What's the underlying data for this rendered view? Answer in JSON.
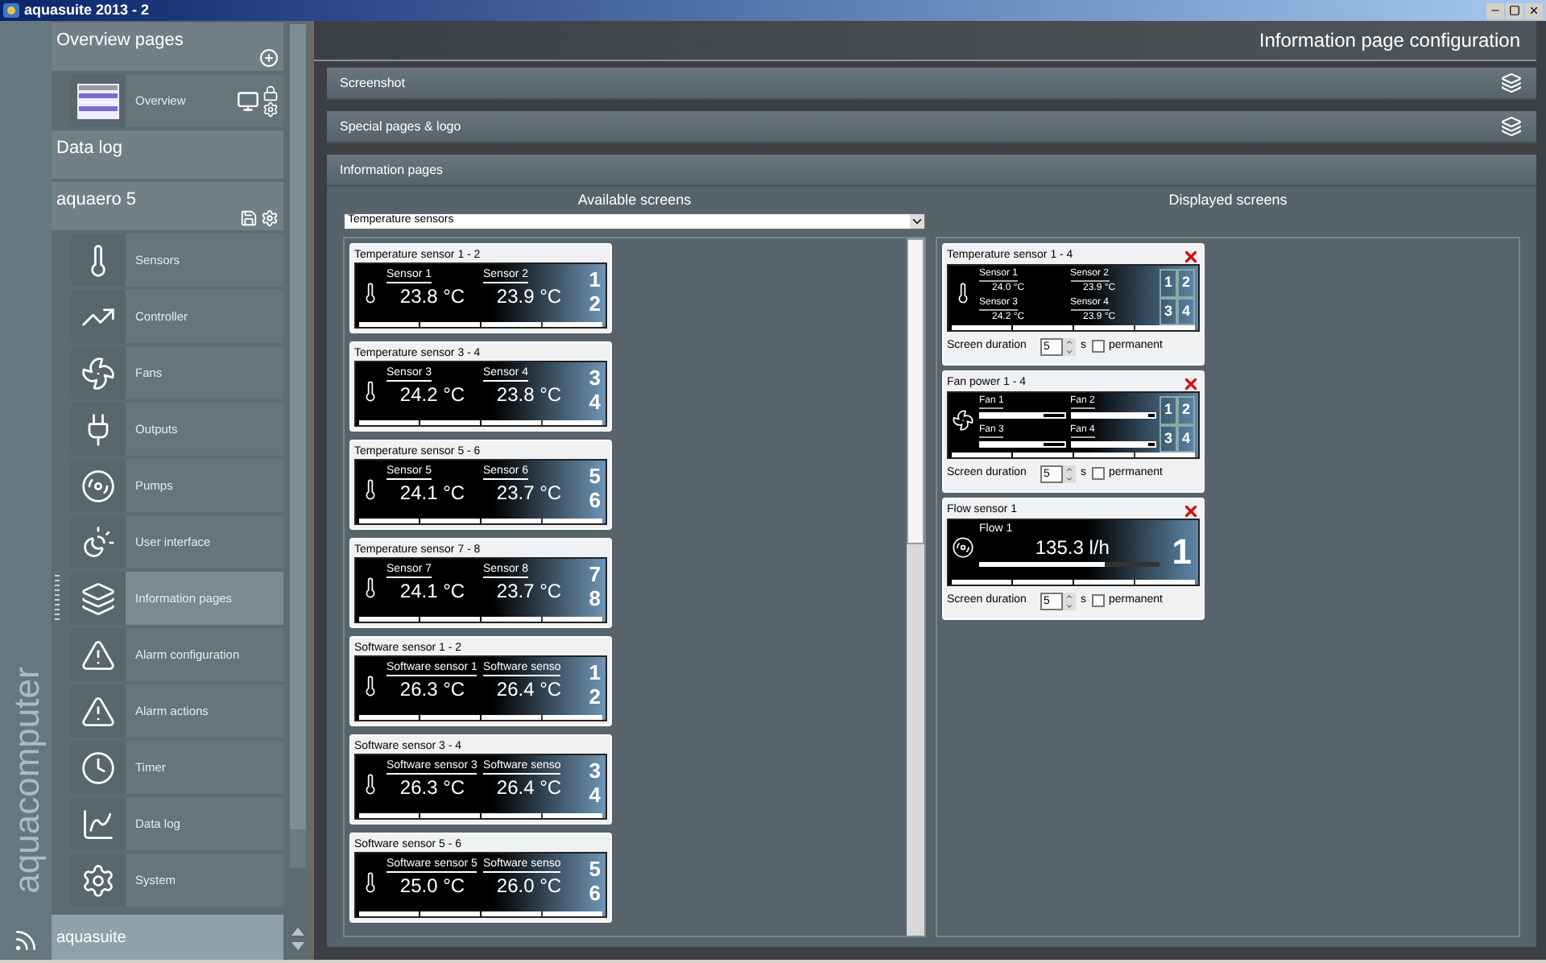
{
  "window": {
    "title": "aquasuite 2013 - 2"
  },
  "sidebar": {
    "brand": "aquacomputer",
    "footer": "aquasuite",
    "sections": [
      {
        "kind": "overview",
        "title": "Overview pages",
        "items": [
          {
            "label": "Overview",
            "selected": false
          }
        ]
      },
      {
        "kind": "plain",
        "title": "Data log"
      },
      {
        "kind": "device",
        "title": "aquaero 5",
        "items": [
          {
            "label": "Sensors",
            "selected": false
          },
          {
            "label": "Controller",
            "selected": false
          },
          {
            "label": "Fans",
            "selected": false
          },
          {
            "label": "Outputs",
            "selected": false
          },
          {
            "label": "Pumps",
            "selected": false
          },
          {
            "label": "User interface",
            "selected": false
          },
          {
            "label": "Information pages",
            "selected": true
          },
          {
            "label": "Alarm configuration",
            "selected": false
          },
          {
            "label": "Alarm actions",
            "selected": false
          },
          {
            "label": "Timer",
            "selected": false
          },
          {
            "label": "Data log",
            "selected": false
          },
          {
            "label": "System",
            "selected": false
          }
        ]
      }
    ]
  },
  "header": {
    "title": "Information page configuration"
  },
  "panels": [
    {
      "title": "Screenshot",
      "expanded": false
    },
    {
      "title": "Special pages & logo",
      "expanded": false
    },
    {
      "title": "Information pages",
      "expanded": true,
      "available": {
        "heading": "Available screens",
        "filter": "Temperature sensors",
        "screens": [
          {
            "title": "Temperature sensor 1 - 2",
            "sensors": [
              {
                "label": "Sensor 1",
                "value": "23.8 °C",
                "number": "1"
              },
              {
                "label": "Sensor 2",
                "value": "23.9 °C",
                "number": "2"
              }
            ]
          },
          {
            "title": "Temperature sensor 3 - 4",
            "sensors": [
              {
                "label": "Sensor 3",
                "value": "24.2 °C",
                "number": "3"
              },
              {
                "label": "Sensor 4",
                "value": "23.8 °C",
                "number": "4"
              }
            ]
          },
          {
            "title": "Temperature sensor 5 - 6",
            "sensors": [
              {
                "label": "Sensor 5",
                "value": "24.1 °C",
                "number": "5"
              },
              {
                "label": "Sensor 6",
                "value": "23.7 °C",
                "number": "6"
              }
            ]
          },
          {
            "title": "Temperature sensor 7 - 8",
            "sensors": [
              {
                "label": "Sensor 7",
                "value": "24.1 °C",
                "number": "7"
              },
              {
                "label": "Sensor 8",
                "value": "23.7 °C",
                "number": "8"
              }
            ]
          },
          {
            "title": "Software sensor 1 - 2",
            "sensors": [
              {
                "label": "Software sensor 1",
                "value": "26.3 °C",
                "number": "1"
              },
              {
                "label": "Software senso",
                "value": "26.4 °C",
                "number": "2"
              }
            ]
          },
          {
            "title": "Software sensor 3 - 4",
            "sensors": [
              {
                "label": "Software sensor 3",
                "value": "26.3 °C",
                "number": "3"
              },
              {
                "label": "Software senso",
                "value": "26.4 °C",
                "number": "4"
              }
            ]
          },
          {
            "title": "Software sensor 5 - 6",
            "sensors": [
              {
                "label": "Software sensor 5",
                "value": "25.0 °C",
                "number": "5"
              },
              {
                "label": "Software senso",
                "value": "26.0 °C",
                "number": "6"
              }
            ]
          }
        ]
      },
      "displayed": {
        "heading": "Displayed screens",
        "screens": [
          {
            "kind": "temperature",
            "title": "Temperature sensor 1 - 4",
            "duration_label": "Screen duration",
            "duration": "5",
            "unit": "s",
            "permanent_label": "permanent",
            "permanent": false,
            "sensors": [
              {
                "label": "Sensor 1",
                "value": "24.0 °C",
                "number": "1"
              },
              {
                "label": "Sensor 2",
                "value": "23.9 °C",
                "number": "2"
              },
              {
                "label": "Sensor 3",
                "value": "24.2 °C",
                "number": "3"
              },
              {
                "label": "Sensor 4",
                "value": "23.9 °C",
                "number": "4"
              }
            ]
          },
          {
            "kind": "fan",
            "title": "Fan power 1 - 4",
            "duration_label": "Screen duration",
            "duration": "5",
            "unit": "s",
            "permanent_label": "permanent",
            "permanent": false,
            "sensors": [
              {
                "label": "Fan 1",
                "level": 0.75,
                "number": "1"
              },
              {
                "label": "Fan 2",
                "level": 0.92,
                "number": "2"
              },
              {
                "label": "Fan 3",
                "level": 0.75,
                "number": "3"
              },
              {
                "label": "Fan 4",
                "level": 0.92,
                "number": "4"
              }
            ]
          },
          {
            "kind": "flow",
            "title": "Flow sensor 1",
            "duration_label": "Screen duration",
            "duration": "5",
            "unit": "s",
            "permanent_label": "permanent",
            "permanent": false,
            "sensors": [
              {
                "label": "Flow 1",
                "value": "135.3 l/h",
                "number": "1",
                "level": 0.7
              }
            ]
          }
        ]
      }
    }
  ]
}
